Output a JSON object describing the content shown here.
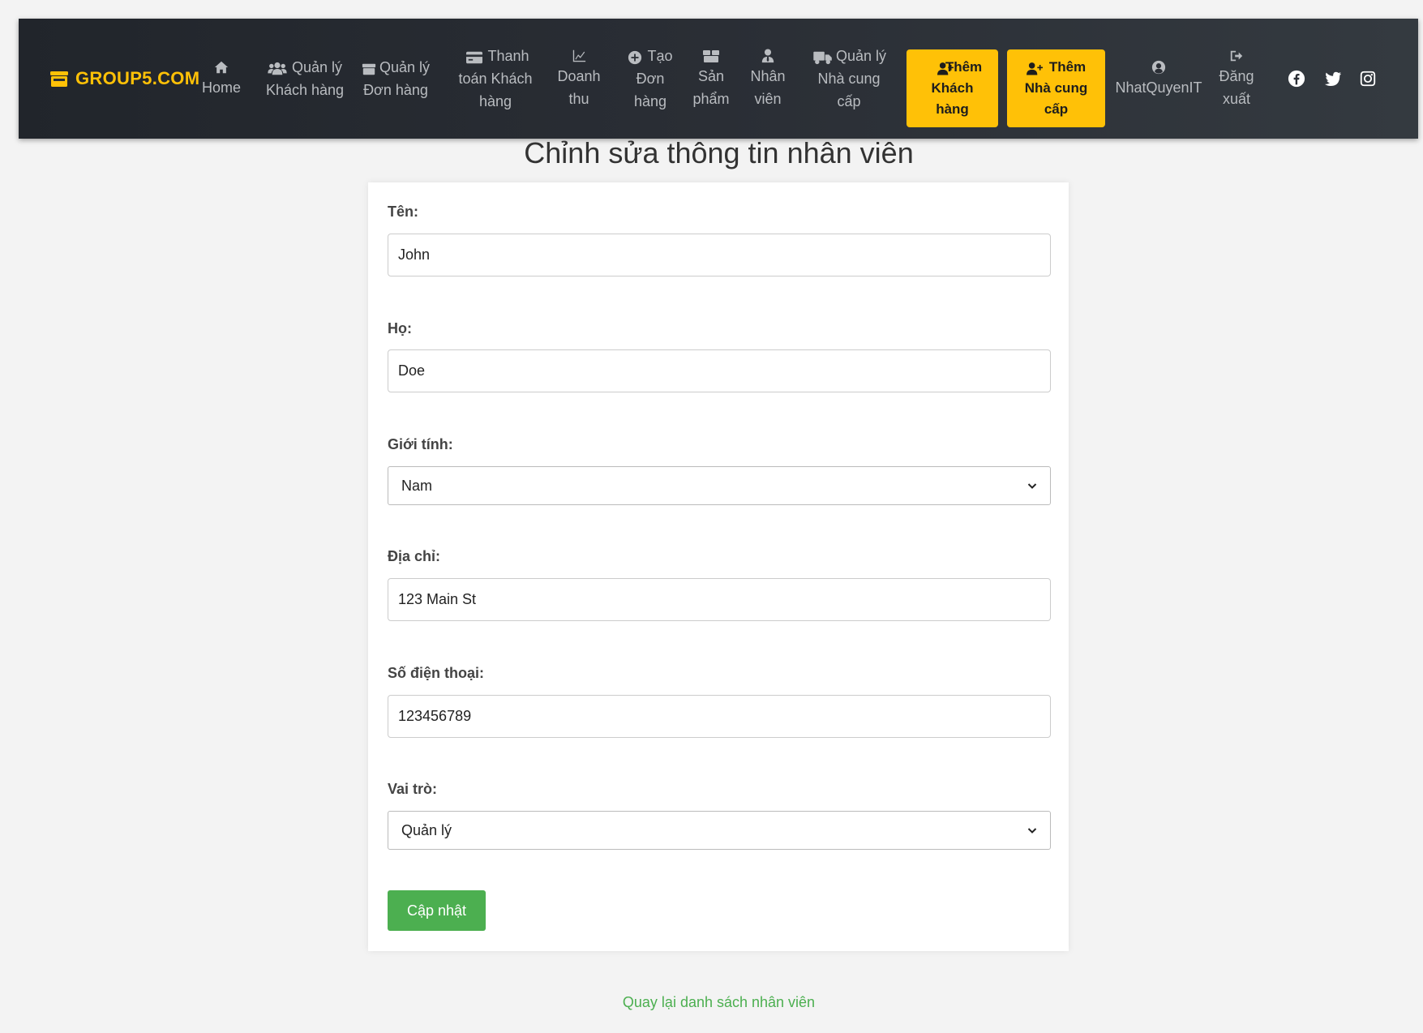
{
  "navbar": {
    "brand": "GROUP5.COM",
    "items": [
      {
        "label": "Home",
        "icon": "home-icon"
      },
      {
        "label": "Quản lý\nKhách hàng",
        "icon": "users-icon"
      },
      {
        "label": "Quản lý\nĐơn hàng",
        "icon": "box-icon"
      },
      {
        "label": "Thanh\ntoán Khách\nhàng",
        "icon": "credit-card-icon"
      },
      {
        "label": "Doanh\nthu",
        "icon": "chart-line-icon"
      },
      {
        "label": "Tạo\nĐơn\nhàng",
        "icon": "plus-circle-icon"
      },
      {
        "label": "Sản\nphẩm",
        "icon": "boxes-icon"
      },
      {
        "label": "Nhân\nviên",
        "icon": "user-tie-icon"
      },
      {
        "label": "Quản lý\nNhà cung\ncấp",
        "icon": "truck-icon"
      }
    ],
    "add_customer": "Thêm\nKhách\nhàng",
    "add_supplier": "Thêm\nNhà cung\ncấp",
    "username": "NhatQuyenIT",
    "logout": "Đăng\nxuất",
    "social": [
      "facebook-icon",
      "twitter-icon",
      "instagram-icon"
    ],
    "accent_color": "#ffc107"
  },
  "page_title": "Chỉnh sửa thông tin nhân viên",
  "form": {
    "first_name_label": "Tên:",
    "first_name_value": "John",
    "last_name_label": "Họ:",
    "last_name_value": "Doe",
    "gender_label": "Giới tính:",
    "gender_value": "Nam",
    "address_label": "Địa chỉ:",
    "address_value": "123 Main St",
    "phone_label": "Số điện thoại:",
    "phone_value": "123456789",
    "role_label": "Vai trò:",
    "role_value": "Quản lý",
    "submit_label": "Cập nhật",
    "submit_color": "#4caf50"
  },
  "back_link": "Quay lại danh sách nhân viên"
}
